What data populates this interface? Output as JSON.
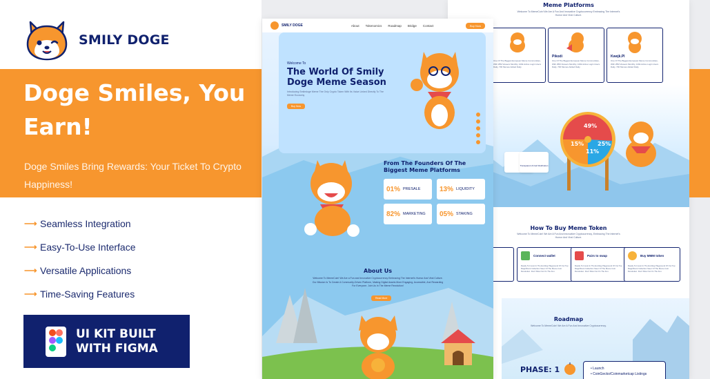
{
  "brand": {
    "name": "SMILY DOGE",
    "logo_icon": "shiba-mascot-icon"
  },
  "hero": {
    "headline": "Doge Smiles, You Earn!",
    "subhead": "Doge Smiles Bring Rewards: Your Ticket To Crypto Happiness!"
  },
  "features": [
    {
      "label": "Seamless Integration"
    },
    {
      "label": "Easy-To-Use Interface"
    },
    {
      "label": "Versatile Applications"
    },
    {
      "label": "Time-Saving Features"
    }
  ],
  "figma_badge": {
    "line1": "UI KIT BUILT",
    "line2": "WITH FIGMA",
    "icon": "figma-logo-icon"
  },
  "colors": {
    "orange": "#f7962e",
    "navy": "#10216e",
    "white": "#ffffff"
  },
  "mockup_center": {
    "nav": {
      "brand": "SMILY DOGE",
      "links": [
        "About",
        "Tokenomics",
        "Roadmap",
        "Bridge",
        "Contact"
      ],
      "cta": "Buy Now"
    },
    "hero": {
      "welcome": "Welcome To",
      "title": "The World Of Smily Doge Meme Season",
      "desc": "Introducing Smiledoge Meme The Only Crypto Token With Its Value Linked Directly To The Meme Economy",
      "cta": "Buy Now"
    },
    "founders": {
      "title": "From The Founders Of The Biggest Meme Platforms",
      "stats": [
        {
          "pct": "01%",
          "label": "PRESALE"
        },
        {
          "pct": "13%",
          "label": "LIQUIDITY"
        },
        {
          "pct": "82%",
          "label": "MARKETING"
        },
        {
          "pct": "05%",
          "label": "STAKING"
        }
      ]
    },
    "about": {
      "title": "About Us",
      "desc": "Welcome To MemeCoin! We Are a Fun and Innovative Cryptocurrency Embracing The Internet's Humor And Viral Culture. Our Mission Is To Create A Community-Driven Platform, Making Digital Assets More Engaging, Accessible, And Rewarding For Everyone. Join Us In The Meme Revolution!",
      "cta": "Read More"
    }
  },
  "mockup_right": {
    "platforms": {
      "title": "Meme Platforms",
      "desc": "Welcome To MemeCoin! We Are A Fun And Innovative Cryptocurrency Embracing The Internet's Humor And Viral Culture.",
      "cards": [
        {
          "name": "",
          "desc": "One Of The Biggest European Meme Communities, With 25M Viewers Monthly, 100k Active Login Users Daily, 700 Memes Added Daily."
        },
        {
          "name": "Pikodi",
          "desc": "One Of The Biggest European Meme Communities, With 25M Viewers Monthly, 100k Active Login Users Daily, 700 Memes Added Daily."
        },
        {
          "name": "Kwejk.Pl",
          "desc": "One Of The Biggest European Meme Communities, With 25M Viewers Monthly, 100k Active Login Users Daily, 700 Memes Added Daily."
        }
      ]
    },
    "wheel": {
      "segments": [
        "49%",
        "15%",
        "25%",
        "11%"
      ]
    },
    "mid_cards": [
      {
        "label": "Transparent & Fair Distribution"
      }
    ],
    "how_to_buy": {
      "title": "How To Buy Meme Token",
      "desc": "Welcome To MemeCoin! We Are A Fun And Innovative Cryptocurrency, Embracing The Internet's Humor And Viral Culture.",
      "steps": [
        {
          "name": "Connect wallet",
          "desc": "Ready To Invest In The Exciting Playground Of Our Top Magnificent Collection Steer Of The Meme Coin Revolution. Don't Miss Out On The Fun."
        },
        {
          "name": "Pairs to swap",
          "desc": "Ready To Invest In The Exciting Playground Of Our Top Magnificent Collection Steer Of The Meme Coin Revolution. Don't Miss Out On The Fun."
        },
        {
          "name": "Buy MMM token",
          "desc": "Ready To Invest In The Exciting Playground Of Our Top Magnificent Collection Steer Of The Meme Coin Revolution. Don't Miss Out On The Fun."
        }
      ]
    },
    "roadmap": {
      "title": "Roadmap",
      "desc": "Welcome To MemeCoin! We Are A Fun And Innovative Cryptocurrency.",
      "phase": "PHASE: 1",
      "items": [
        "Launch",
        "CoinGecko/Coinmarketcap Listings"
      ]
    }
  }
}
